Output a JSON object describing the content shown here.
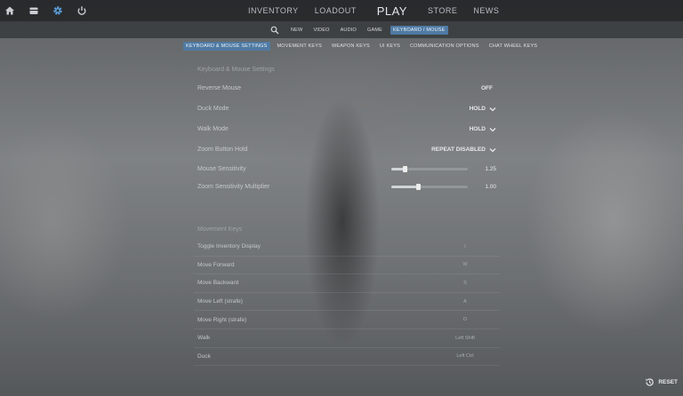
{
  "nav": {
    "icons": [
      "home-icon",
      "inventory-box-icon",
      "settings-gear-icon",
      "power-icon"
    ],
    "tabs": [
      "INVENTORY",
      "LOADOUT",
      "PLAY",
      "STORE",
      "NEWS"
    ]
  },
  "subnav": {
    "tabs": [
      "NEW",
      "VIDEO",
      "AUDIO",
      "GAME",
      "KEYBOARD / MOUSE"
    ],
    "active": "KEYBOARD / MOUSE"
  },
  "keytabs": {
    "tabs": [
      "KEYBOARD & MOUSE SETTINGS",
      "MOVEMENT KEYS",
      "WEAPON KEYS",
      "UI KEYS",
      "COMMUNICATION OPTIONS",
      "CHAT WHEEL KEYS"
    ],
    "active": "KEYBOARD & MOUSE SETTINGS"
  },
  "settings": {
    "title": "Keyboard & Mouse Settings",
    "rows": [
      {
        "label": "Reverse Mouse",
        "value": "OFF"
      },
      {
        "label": "Duck Mode",
        "value": "HOLD"
      },
      {
        "label": "Walk Mode",
        "value": "HOLD"
      },
      {
        "label": "Zoom Button Hold",
        "value": "REPEAT DISABLED"
      }
    ],
    "sliders": [
      {
        "label": "Mouse Sensitivity",
        "value": "1.25",
        "fraction": 0.18
      },
      {
        "label": "Zoom Sensitivity Multiplier",
        "value": "1.00",
        "fraction": 0.35
      }
    ]
  },
  "movement": {
    "title": "Movement Keys",
    "binds": [
      {
        "label": "Toggle Inventory Display",
        "key": "I"
      },
      {
        "label": "Move Forward",
        "key": "W"
      },
      {
        "label": "Move Backward",
        "key": "S"
      },
      {
        "label": "Move Left (strafe)",
        "key": "A"
      },
      {
        "label": "Move Right (strafe)",
        "key": "D"
      },
      {
        "label": "Walk",
        "key": "Left Shift"
      },
      {
        "label": "Duck",
        "key": "Left Ctrl"
      }
    ]
  },
  "footer": {
    "reset_label": "RESET"
  }
}
